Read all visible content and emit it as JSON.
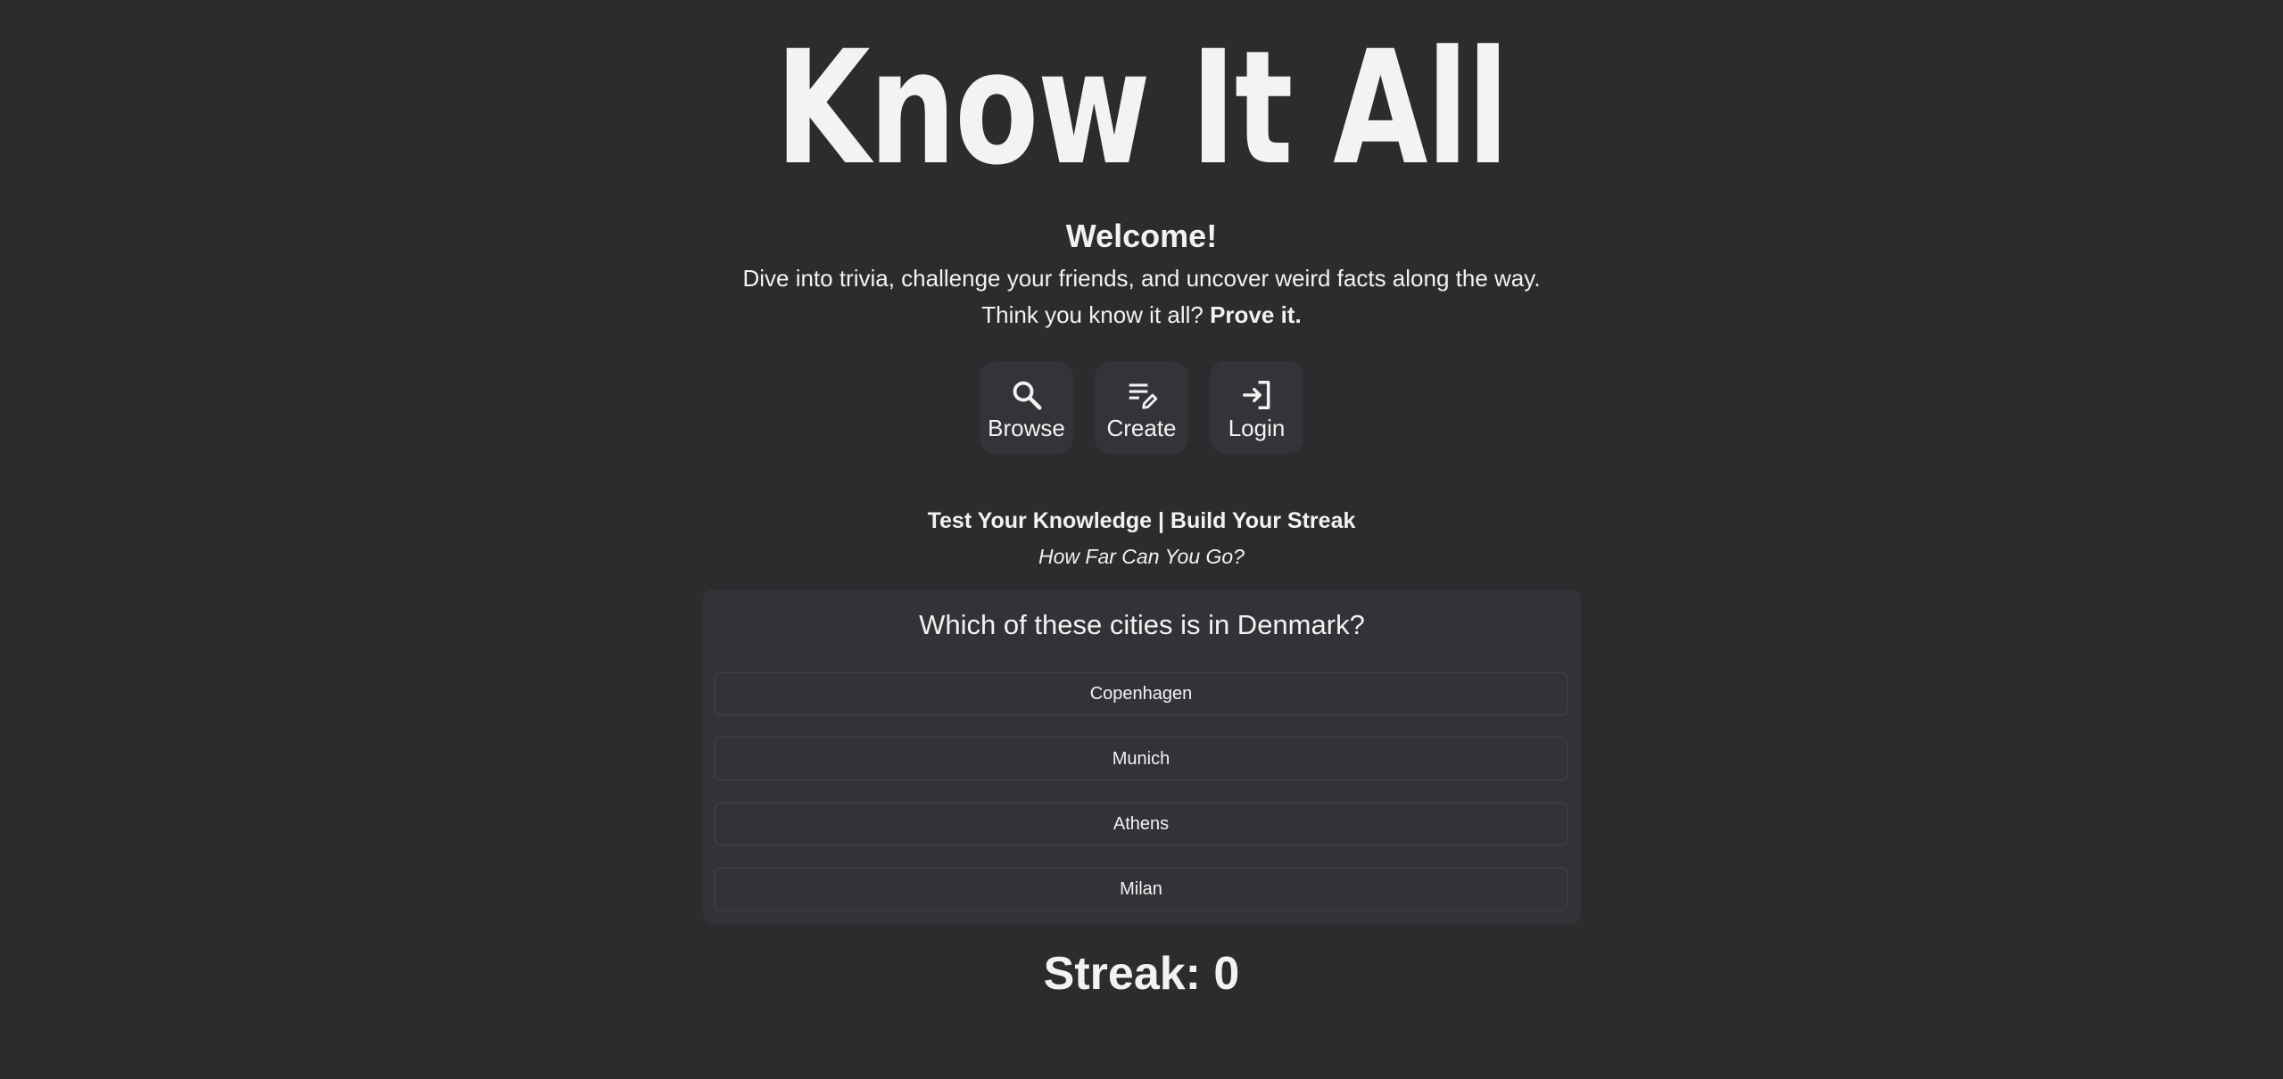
{
  "app": {
    "logo_text": "Know It All"
  },
  "hero": {
    "welcome": "Welcome!",
    "tagline": "Dive into trivia, challenge your friends, and uncover weird facts along the way.",
    "prove_prefix": "Think you know it all?",
    "prove_emphasis": "Prove it."
  },
  "actions": [
    {
      "label": "Browse",
      "icon": "search-icon"
    },
    {
      "label": "Create",
      "icon": "edit-list-icon"
    },
    {
      "label": "Login",
      "icon": "login-icon"
    }
  ],
  "quiz": {
    "heading": "Test Your Knowledge | Build Your Streak",
    "subheading": "How Far Can You Go?",
    "question": "Which of these cities is in Denmark?",
    "answers": [
      "Copenhagen",
      "Munich",
      "Athens",
      "Milan"
    ]
  },
  "streak": {
    "label": "Streak: 0"
  },
  "colors": {
    "background": "#2b2c2e",
    "card": "#313337",
    "button": "#323438",
    "text": "#f2f2f2"
  }
}
